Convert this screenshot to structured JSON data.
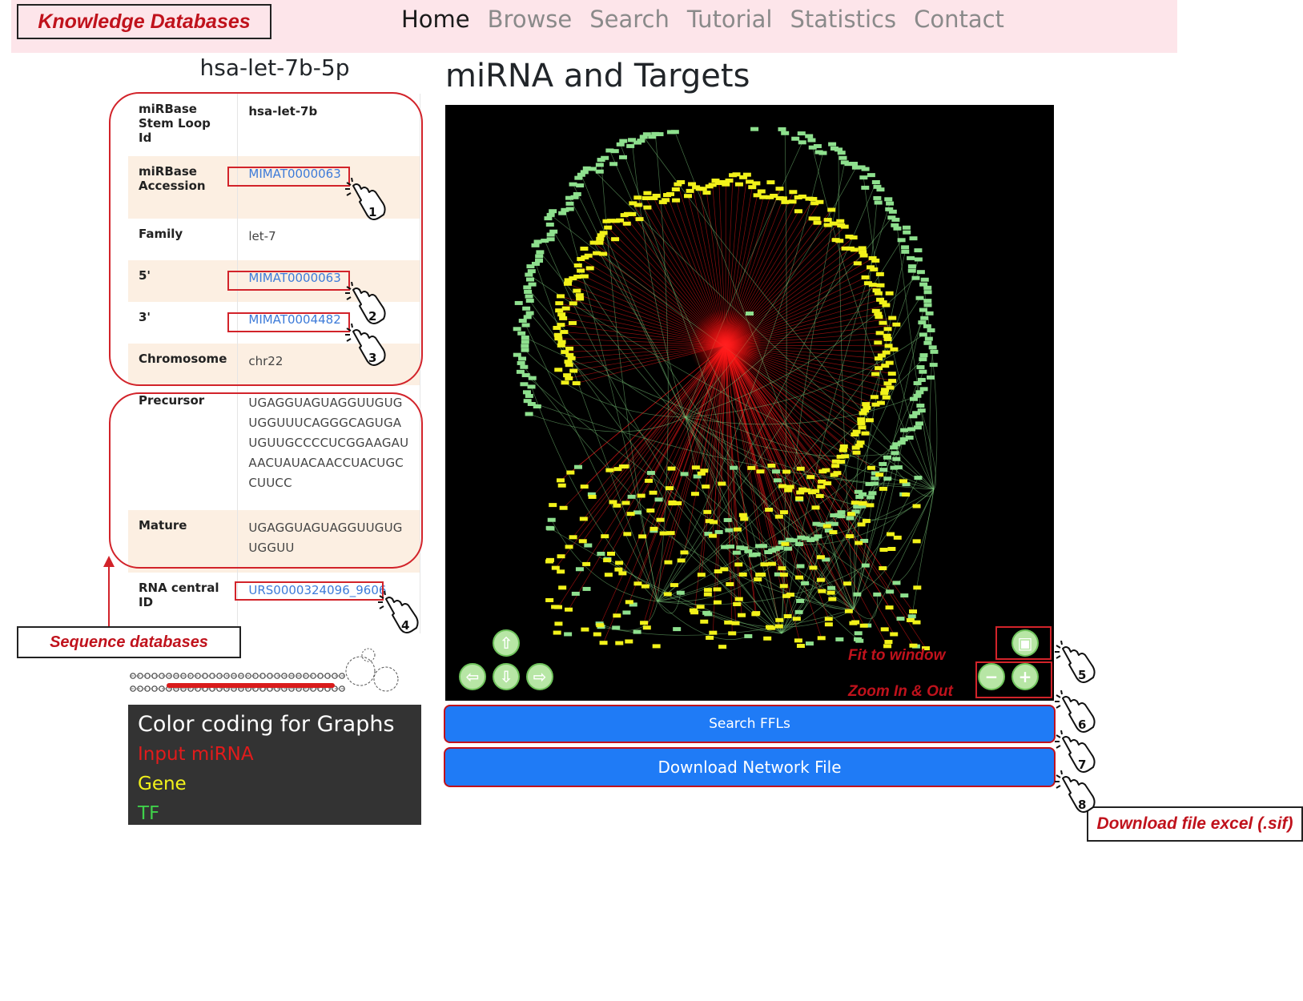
{
  "header": {
    "title_box": "Knowledge Databases",
    "nav": [
      "Home",
      "Browse",
      "Search",
      "Tutorial",
      "Statistics",
      "Contact"
    ],
    "active_nav": "Home"
  },
  "mirna": {
    "name": "hsa-let-7b-5p",
    "rows": [
      {
        "key": "miRBase Stem Loop Id",
        "value": "hsa-let-7b",
        "link": false
      },
      {
        "key": "miRBase Accession",
        "value": "MIMAT0000063",
        "link": true
      },
      {
        "key": "Family",
        "value": "let-7",
        "link": false
      },
      {
        "key": "5'",
        "value": "MIMAT0000063",
        "link": true
      },
      {
        "key": "3'",
        "value": "MIMAT0004482",
        "link": true
      },
      {
        "key": "Chromosome",
        "value": "chr22",
        "link": false
      },
      {
        "key": "Precursor",
        "value": "UGAGGUAGUAGGUUGUGUGGUUUCAGGGCAGUGAUGUUGCCCCUCGGAAGAUAACUAUACAACCUACUGCCUUCC",
        "link": false
      },
      {
        "key": "Mature",
        "value": "UGAGGUAGUAGGUUGUGUGGUU",
        "link": false
      },
      {
        "key": "RNA central ID",
        "value": "URS0000324096_9606",
        "link": true
      }
    ]
  },
  "annotations": {
    "sequence_databases": "Sequence databases",
    "fit_to_window": "Fit to window",
    "zoom_in_out": "Zoom In & Out",
    "download_excel": "Download file excel (.sif)",
    "hand_numbers": [
      "1",
      "2",
      "3",
      "4",
      "5",
      "6",
      "7",
      "8"
    ]
  },
  "legend": {
    "title": "Color coding for Graphs",
    "items": [
      {
        "label": "Input miRNA",
        "color": "#e21b1b"
      },
      {
        "label": "Gene",
        "color": "#f2f21a"
      },
      {
        "label": "TF",
        "color": "#3fd04a"
      }
    ]
  },
  "main": {
    "section_title": "miRNA and Targets",
    "search_ffls_label": "Search FFLs",
    "download_network_label": "Download Network File"
  },
  "colors": {
    "mirna_node": "#ff1a1a",
    "gene_node": "#f2f21a",
    "tf_node": "#8ee08e",
    "annotation_red": "#c0121c",
    "button_blue": "#1f7bf6",
    "topbar_pink": "#fde5ea"
  }
}
